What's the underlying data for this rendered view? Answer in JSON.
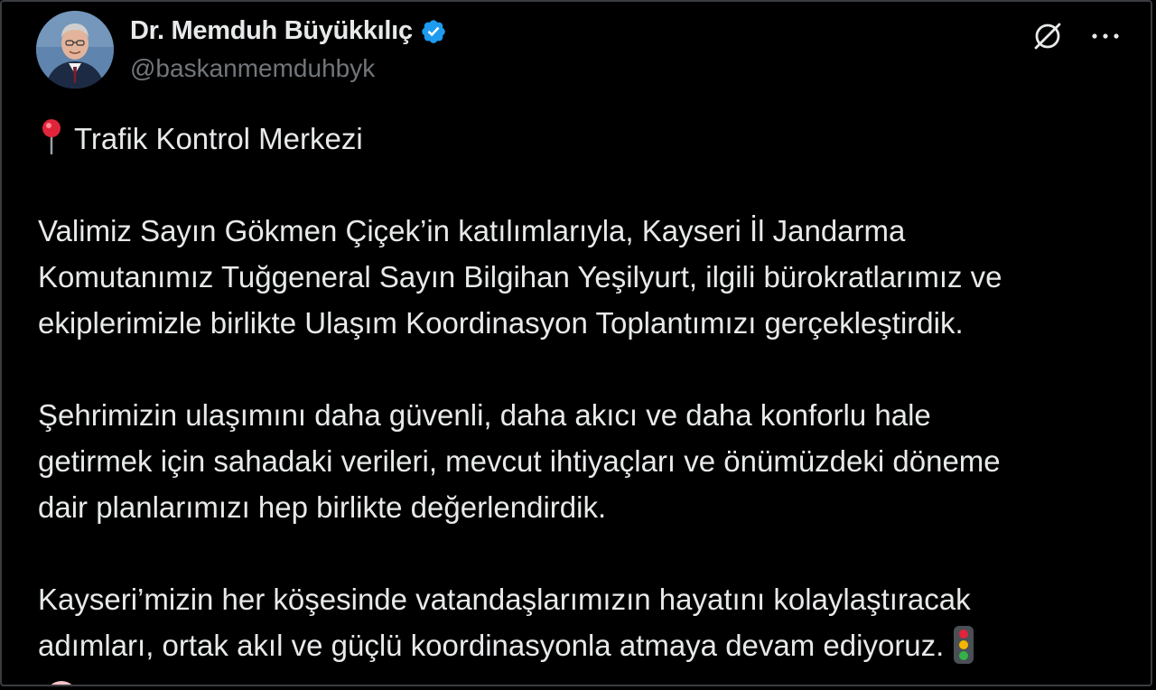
{
  "author": {
    "display_name": "Dr. Memduh Büyükkılıç",
    "handle": "@baskanmemduhbyk",
    "verified": true
  },
  "icons": {
    "verified": "verified-badge-icon",
    "grok": "grok-slash-icon",
    "more": "more-horizontal-icon",
    "pin": "round-pushpin-emoji",
    "traffic_light": "vertical-traffic-light-emoji"
  },
  "colors": {
    "background": "#000000",
    "text": "#e7e9ea",
    "muted": "#71767b",
    "verified_blue": "#1d9bf0"
  },
  "post": {
    "title": "Trafik Kontrol Merkezi",
    "para1_lines": [
      "Valimiz Sayın Gökmen Çiçek’in katılımlarıyla, Kayseri İl Jandarma",
      "Komutanımız Tuğgeneral Sayın Bilgihan Yeşilyurt, ilgili bürokratlarımız ve",
      "ekiplerimizle birlikte Ulaşım Koordinasyon Toplantımızı gerçekleştirdik."
    ],
    "para2_lines": [
      "Şehrimizin ulaşımını daha güvenli, daha akıcı ve daha konforlu hale",
      "getirmek için sahadaki verileri, mevcut ihtiyaçları ve önümüzdeki döneme",
      "dair planlarımızı hep birlikte değerlendirdik."
    ],
    "para3_lines": [
      "Kayseri’mizin her köşesinde vatandaşlarımızın hayatını kolaylaştıracak",
      "adımları, ortak akıl ve güçlü koordinasyonla atmaya devam ediyoruz."
    ]
  }
}
